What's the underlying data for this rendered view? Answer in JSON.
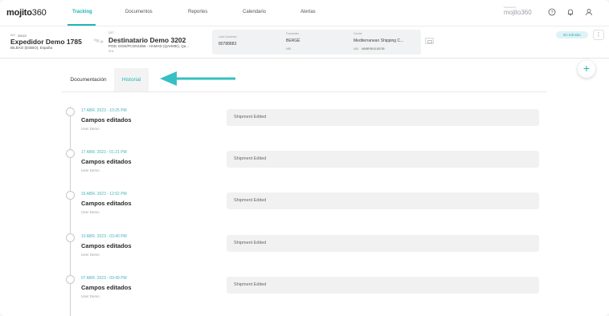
{
  "nav": {
    "logo_main": "mojito",
    "logo_sup": "360",
    "items": [
      {
        "label": "Tracking",
        "active": true
      },
      {
        "label": "Documentos",
        "active": false
      },
      {
        "label": "Reportes",
        "active": false
      },
      {
        "label": "Calendario",
        "active": false
      },
      {
        "label": "Alertas",
        "active": false
      }
    ],
    "right_brand": "mojito360",
    "right_brand_caption": "Powered by",
    "accent_color": "#1fb5b3"
  },
  "shipment": {
    "ref_label": "Ref:",
    "ref_value": "39022",
    "shipper_name": "Expedidor Demo 1785",
    "shipper_location": "BILBAO (ESBIO), España",
    "exp_label": "Exp:",
    "consignee_label": "DST",
    "consignee_name": "Destinatario Demo 3202",
    "route": "POD: DGN/PCGN1856 - HAMAD (QAHMD), Qa...",
    "ship_label": "SHL",
    "last_container_label": "Last Container",
    "last_container_value": "80788883",
    "forwarder_label": "Forwarder",
    "forwarder_value": "BERGÉ",
    "forwarder_sub": "MBL",
    "carrier_label": "Carrier",
    "carrier_value": "Mediterranean Shipping C...",
    "carrier_sub_label": "MBL",
    "carrier_sub_value": "MMBRB03185785",
    "status_badge": "En tránsito",
    "menu_icon": "kebab-icon"
  },
  "tabs": [
    {
      "label": "Documentación",
      "active": false
    },
    {
      "label": "Historial",
      "active": true
    }
  ],
  "fab_symbol": "+",
  "history": [
    {
      "date": "17 ABR. 2023 - 10:25 PM",
      "title": "Campos editados",
      "user": "User Demo",
      "detail": "Shipment Edited"
    },
    {
      "date": "17 ABR. 2023 - 01:21 PM",
      "title": "Campos editados",
      "user": "User Demo",
      "detail": "Shipment Edited"
    },
    {
      "date": "16 ABR. 2023 - 12:02 PM",
      "title": "Campos editados",
      "user": "User Demo",
      "detail": "Shipment Edited"
    },
    {
      "date": "10 ABR. 2023 - 03:40 PM",
      "title": "Campos editados",
      "user": "User Demo",
      "detail": "Shipment Edited"
    },
    {
      "date": "07 ABR. 2023 - 09:49 PM",
      "title": "Campos editados",
      "user": "User Demo",
      "detail": "Shipment Edited"
    }
  ]
}
